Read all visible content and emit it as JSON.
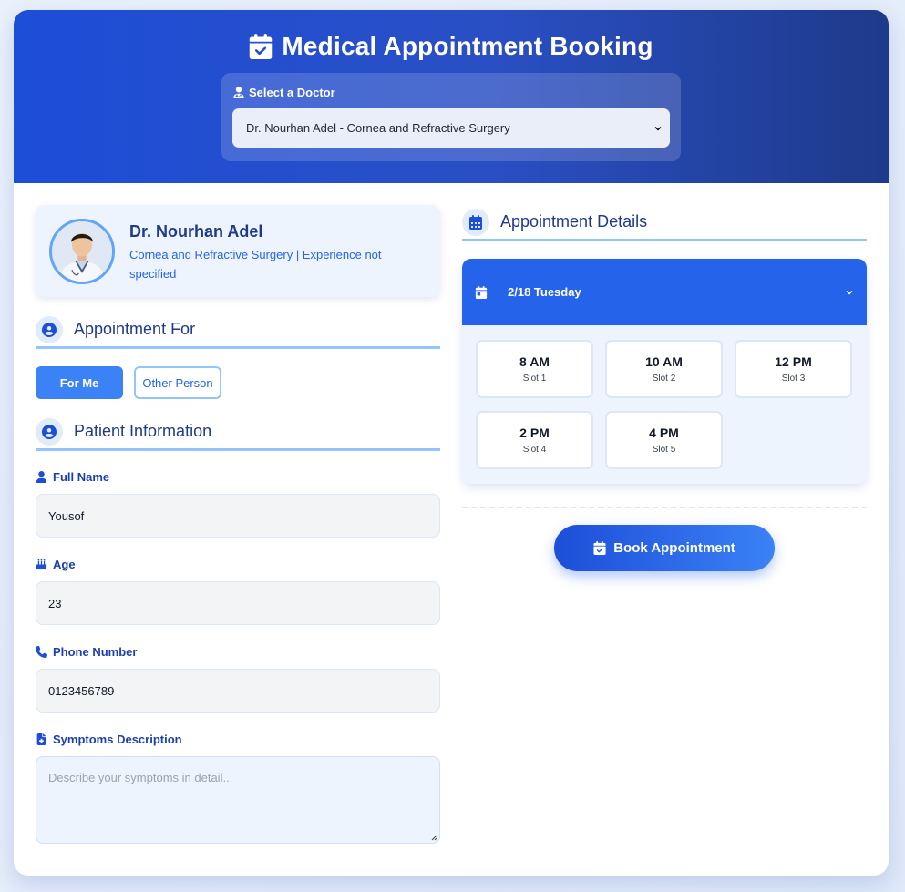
{
  "header": {
    "title": "Medical Appointment Booking",
    "select_label": "Select a Doctor",
    "selected_doctor": "Dr. Nourhan Adel - Cornea and Refractive Surgery"
  },
  "doctor": {
    "name": "Dr. Nourhan Adel",
    "specialty": "Cornea and Refractive Surgery | Experience not specified"
  },
  "appointment_for": {
    "title": "Appointment For",
    "options": [
      "For Me",
      "Other Person"
    ],
    "selected": "For Me"
  },
  "patient": {
    "title": "Patient Information",
    "full_name_label": "Full Name",
    "full_name": "Yousof",
    "age_label": "Age",
    "age": "23",
    "phone_label": "Phone Number",
    "phone": "0123456789",
    "symptoms_label": "Symptoms Description",
    "symptoms_placeholder": "Describe your symptoms in detail..."
  },
  "appointment": {
    "title": "Appointment Details",
    "day": "2/18 Tuesday",
    "slots": [
      {
        "time": "8 AM",
        "label": "Slot 1"
      },
      {
        "time": "10 AM",
        "label": "Slot 2"
      },
      {
        "time": "12 PM",
        "label": "Slot 3"
      },
      {
        "time": "2 PM",
        "label": "Slot 4"
      },
      {
        "time": "4 PM",
        "label": "Slot 5"
      }
    ],
    "book_label": "Book Appointment"
  },
  "colors": {
    "primary": "#2563eb",
    "dark_blue": "#1e3a8a",
    "accent": "#3b82f6"
  }
}
